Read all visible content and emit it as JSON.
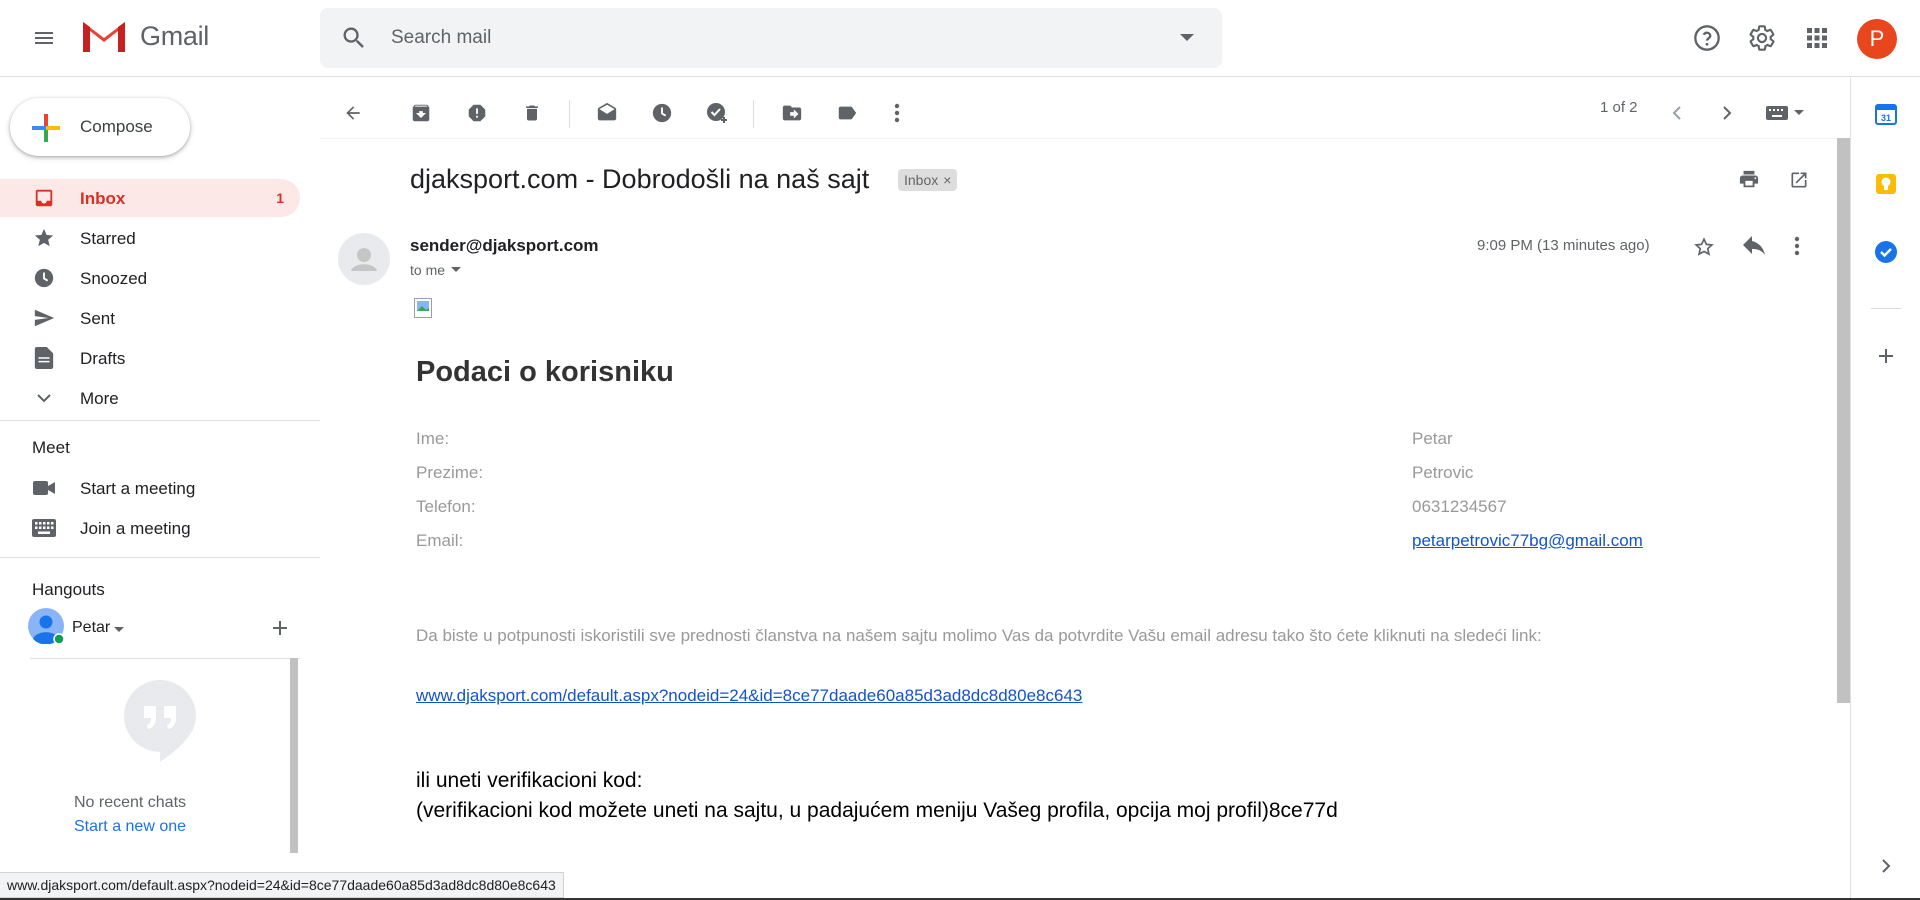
{
  "app": {
    "name": "Gmail",
    "avatar_letter": "P",
    "brand_color": "#ea4335",
    "avatar_color": "#e8471d"
  },
  "search": {
    "placeholder": "Search mail"
  },
  "nav": {
    "compose_label": "Compose",
    "items": [
      {
        "label": "Inbox",
        "icon": "inbox-icon",
        "count": "1",
        "active": true
      },
      {
        "label": "Starred",
        "icon": "star-icon"
      },
      {
        "label": "Snoozed",
        "icon": "clock-icon"
      },
      {
        "label": "Sent",
        "icon": "send-icon"
      },
      {
        "label": "Drafts",
        "icon": "draft-icon"
      },
      {
        "label": "More",
        "icon": "chevron-down-icon"
      }
    ],
    "meet": {
      "title": "Meet",
      "items": [
        {
          "label": "Start a meeting"
        },
        {
          "label": "Join a meeting"
        }
      ]
    },
    "hangouts": {
      "title": "Hangouts",
      "user": "Petar",
      "no_chats": "No recent chats",
      "start_new": "Start a new one"
    }
  },
  "toolbar": {
    "pager": "1 of 2"
  },
  "email": {
    "subject": "djaksport.com - Dobrodošli na naš sajt",
    "label_chip": "Inbox",
    "sender": "sender@djaksport.com",
    "to": "to me",
    "time": "9:09 PM (13 minutes ago)",
    "heading": "Podaci o korisniku",
    "fields": [
      {
        "label": "Ime:",
        "value": "Petar"
      },
      {
        "label": "Prezime:",
        "value": "Petrovic"
      },
      {
        "label": "Telefon:",
        "value": "0631234567"
      },
      {
        "label": "Email:",
        "value": "petarpetrovic77bg@gmail.com"
      }
    ],
    "instructions": "Da biste u potpunosti iskoristili sve prednosti članstva na našem sajtu molimo Vas da potvrdite Vašu email adresu tako što ćete kliknuti na sledeći link:",
    "link": "www.djaksport.com/default.aspx?nodeid=24&id=8ce77daade60a85d3ad8dc8d80e8c643",
    "verify_line1": "ili uneti verifikacioni kod:",
    "verify_line2": "(verifikacioni kod možete uneti na sajtu, u padajućem meniju Vašeg profila, opcija moj profil)8ce77d"
  },
  "statusbar": {
    "url": "www.djaksport.com/default.aspx?nodeid=24&id=8ce77daade60a85d3ad8dc8d80e8c643"
  },
  "rail": {
    "calendar_day": "31"
  }
}
